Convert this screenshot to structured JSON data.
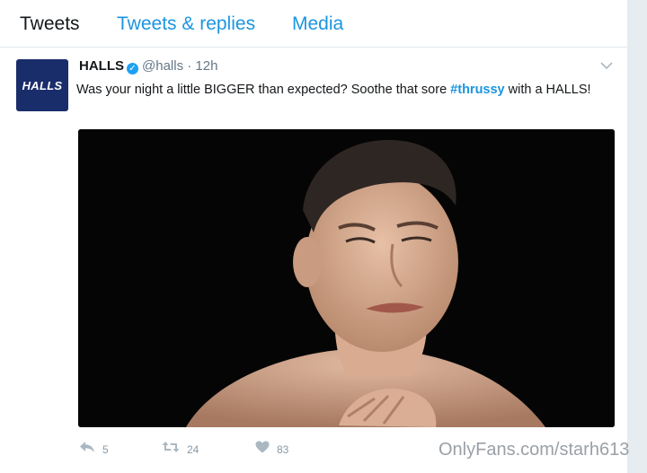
{
  "tabs": [
    {
      "label": "Tweets"
    },
    {
      "label": "Tweets & replies"
    },
    {
      "label": "Media"
    }
  ],
  "tweet": {
    "avatar_text": "HALLS",
    "name": "HALLS",
    "handle": "@halls",
    "separator": "·",
    "time": "12h",
    "text_before": "Was your night a little BIGGER than expected? Soothe that sore ",
    "hashtag": "#thrussy",
    "text_after": " with a HALLS!",
    "reply_count": "5",
    "retweet_count": "24",
    "like_count": "83"
  },
  "watermark": "OnlyFans.com/starh613",
  "colors": {
    "link_blue": "#1b95e0",
    "avatar_navy": "#1a2d6b",
    "verified_blue": "#1da1f2"
  },
  "icons": {
    "reply": "reply-icon",
    "retweet": "retweet-icon",
    "like": "heart-icon",
    "menu": "chevron-down-icon",
    "verified": "verified-badge-icon"
  }
}
